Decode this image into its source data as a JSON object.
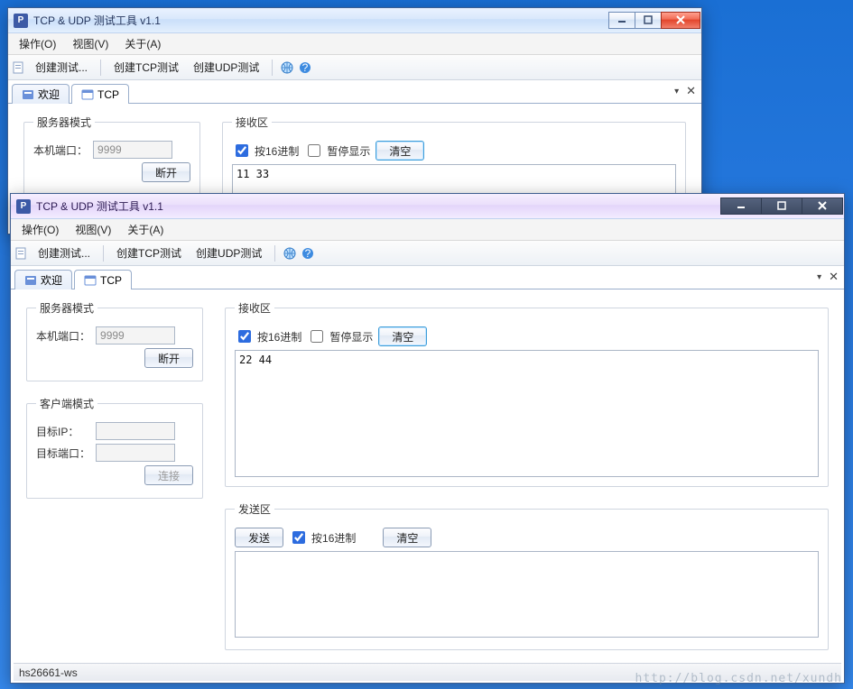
{
  "app": {
    "title": "TCP & UDP 测试工具 v1.1",
    "menus": {
      "operate": "操作(O)",
      "view": "视图(V)",
      "about": "关于(A)"
    },
    "toolbar": {
      "createTest": "创建测试...",
      "createTcp": "创建TCP测试",
      "createUdp": "创建UDP测试"
    },
    "tabs": {
      "welcome": "欢迎",
      "tcp": "TCP"
    }
  },
  "labels": {
    "serverGroup": "服务器模式",
    "clientGroup": "客户端模式",
    "recvGroup": "接收区",
    "sendGroup": "发送区",
    "localPort": "本机端口：",
    "targetIp": "目标IP：",
    "targetPort": "目标端口：",
    "hex": "按16进制",
    "pause": "暂停显示",
    "clear": "清空",
    "send": "发送",
    "disconnect": "断开",
    "connect": "连接"
  },
  "win1": {
    "port": "9999",
    "recv": "11 33"
  },
  "win2": {
    "port": "9999",
    "targetIp": "",
    "targetPort": "",
    "recv": "22 44",
    "send": "",
    "status": "hs26661-ws"
  },
  "watermark": "http://blog.csdn.net/xundh"
}
